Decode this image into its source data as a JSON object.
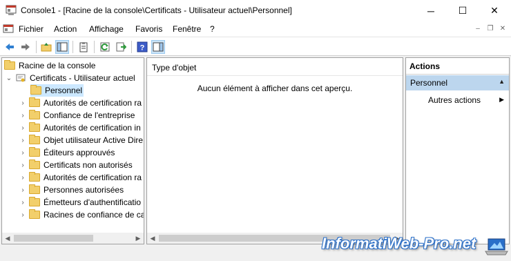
{
  "window": {
    "title": "Console1 - [Racine de la console\\Certificats - Utilisateur actuel\\Personnel]",
    "minimize_glyph": "─",
    "maximize_glyph": "☐",
    "close_glyph": "✕"
  },
  "menu": {
    "items": [
      "Fichier",
      "Action",
      "Affichage",
      "Favoris",
      "Fenêtre",
      "?"
    ],
    "mdi_minimize": "–",
    "mdi_restore": "❐",
    "mdi_close": "✕"
  },
  "toolbar": {
    "buttons": [
      "back-icon",
      "forward-icon",
      "up-folder-icon",
      "show-hide-tree-icon",
      "clipboard-icon",
      "refresh-icon",
      "export-list-icon",
      "help-icon",
      "show-hide-action-pane-icon"
    ]
  },
  "tree": {
    "root": "Racine de la console",
    "store": "Certificats - Utilisateur actuel",
    "items": [
      "Personnel",
      "Autorités de certification ra",
      "Confiance de l'entreprise",
      "Autorités de certification in",
      "Objet utilisateur Active Dire",
      "Éditeurs approuvés",
      "Certificats non autorisés",
      "Autorités de certification ra",
      "Personnes autorisées",
      "Émetteurs d'authentificatio",
      "Racines de confiance de ca"
    ]
  },
  "center": {
    "column_header": "Type d'objet",
    "empty_message": "Aucun élément à afficher dans cet aperçu."
  },
  "actions": {
    "header": "Actions",
    "section": "Personnel",
    "more_actions": "Autres actions"
  },
  "watermark": "InformatiWeb-Pro.net",
  "colors": {
    "selection": "#cce8ff",
    "actions_selected": "#bcd6ee",
    "accent": "#2a6fc9"
  }
}
